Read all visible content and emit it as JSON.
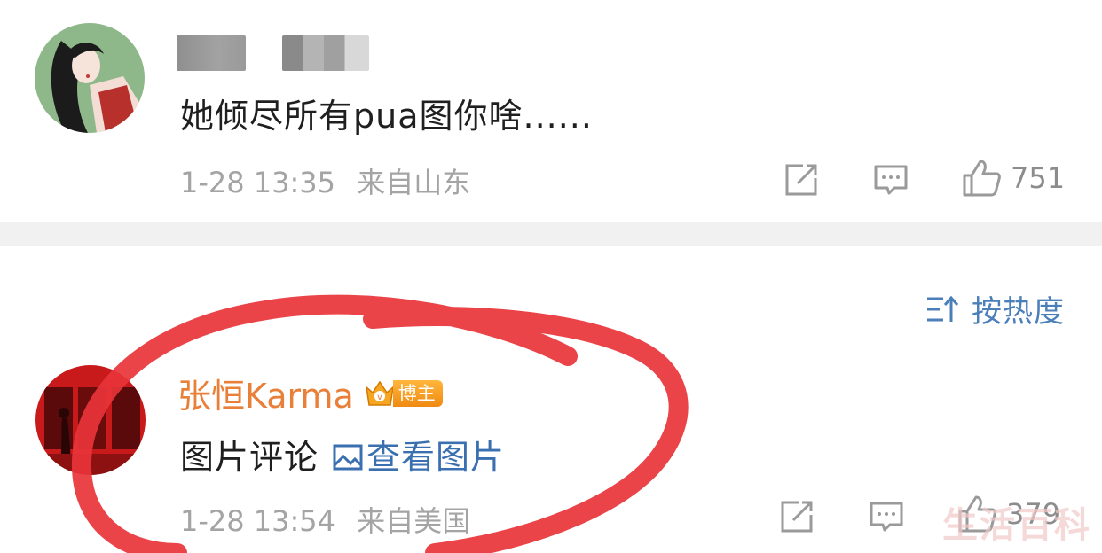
{
  "comments": [
    {
      "text": "她倾尽所有pua图你啥......",
      "time": "1-28 13:35",
      "location": "来自山东",
      "like_count": "751"
    },
    {
      "author": "张恒Karma",
      "badge": "博主",
      "text": "图片评论",
      "link_text": "查看图片",
      "time": "1-28 13:54",
      "location": "来自美国",
      "like_count": "379"
    }
  ],
  "sort": {
    "label": "按热度"
  },
  "icons": {
    "share": "share-icon",
    "comment": "comment-icon",
    "like": "thumbs-up-icon",
    "sort": "sort-icon",
    "picture": "picture-icon",
    "badge": "crown-badge-icon"
  },
  "colors": {
    "author": "#e8803a",
    "link": "#3a6fb0",
    "meta": "#a4a4a4",
    "annotation": "#e8343a",
    "divider": "#f1f1f1"
  },
  "watermark": "生活百科"
}
